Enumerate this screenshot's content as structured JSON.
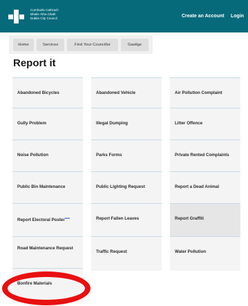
{
  "header": {
    "logo_lines": [
      "Comhairle Cathrach",
      "Bhaile Átha Cliath",
      "Dublin City Council"
    ],
    "create_account": "Create an Account",
    "login": "Login",
    "bg_color": "#066a7b"
  },
  "nav": {
    "items": [
      {
        "label": "Home"
      },
      {
        "label": "Services"
      },
      {
        "label": "Find Your Councillor"
      },
      {
        "label": "Gaeilge"
      }
    ]
  },
  "page_title": "Report it",
  "cards": [
    {
      "label": "Abandoned Bicycles"
    },
    {
      "label": "Abandoned Vehicle"
    },
    {
      "label": "Air Pollution Complaint"
    },
    {
      "label": "Gully Problem"
    },
    {
      "label": "Illegal Dumping"
    },
    {
      "label": "Litter Offence"
    },
    {
      "label": "Noise Pollution"
    },
    {
      "label": "Parks Forms"
    },
    {
      "label": "Private Rented Complaints"
    },
    {
      "label": "Public Bin Maintenance"
    },
    {
      "label": "Public Lighting Request"
    },
    {
      "label": "Report a Dead Animal"
    },
    {
      "label": "Report Electoral Poster",
      "badge": "new"
    },
    {
      "label": "Report Fallen Leaves"
    },
    {
      "label": "Report Graffiti",
      "highlighted": true
    },
    {
      "label": "Road Maintenance Request"
    },
    {
      "label": "Traffic Request"
    },
    {
      "label": "Water Pollution"
    },
    {
      "label": "Bonfire Materials",
      "circled": true
    }
  ],
  "annotation_color": "#e90f0f"
}
